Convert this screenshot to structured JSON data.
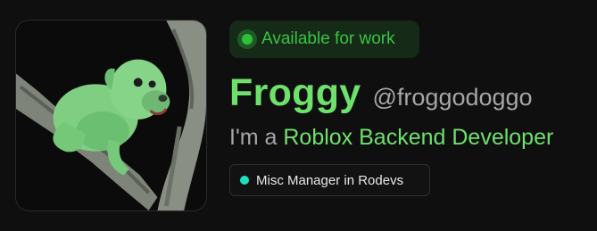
{
  "status": {
    "label": "Available for work",
    "color": "#2fbf3a"
  },
  "profile": {
    "display_name": "Froggy",
    "handle": "@froggodoggo",
    "role_prefix": "I'm a",
    "role_highlight": "Roblox Backend Developer",
    "accent_color": "#6ee06c"
  },
  "affiliation": {
    "label": "Misc Manager in Rodevs",
    "dot_color": "#1ee0c0"
  },
  "avatar": {
    "subject": "frog-dog-photo"
  }
}
